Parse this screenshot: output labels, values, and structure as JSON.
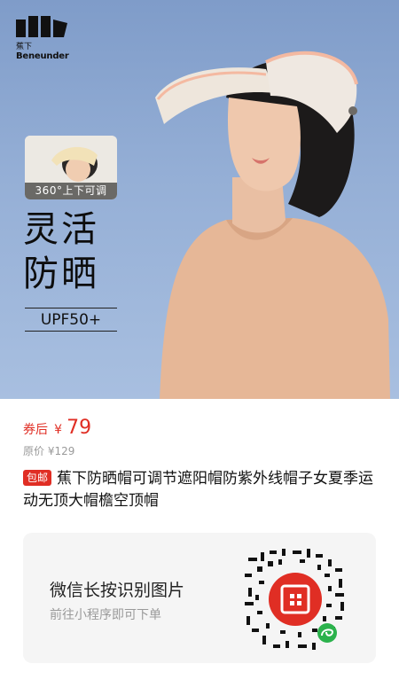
{
  "brand": {
    "name_cn": "蕉下",
    "name_en": "Beneunder"
  },
  "hero": {
    "thumb_label": "360°上下可调",
    "headline_line1": "灵活",
    "headline_line2": "防晒",
    "upf": "UPF50+"
  },
  "price": {
    "coupon_label": "券后",
    "currency": "¥",
    "value": "79",
    "original": "原价 ¥129"
  },
  "product": {
    "badge": "包邮",
    "title": "蕉下防晒帽可调节遮阳帽防紫外线帽子女夏季运动无顶大帽檐空顶帽"
  },
  "card": {
    "title": "微信长按识别图片",
    "subtitle": "前往小程序即可下单",
    "qr_center_icon": "pinduoduo-logo-icon",
    "mini_program_icon": "mini-program-icon"
  },
  "colors": {
    "accent": "#e02e24",
    "sky": "#95afd6"
  }
}
